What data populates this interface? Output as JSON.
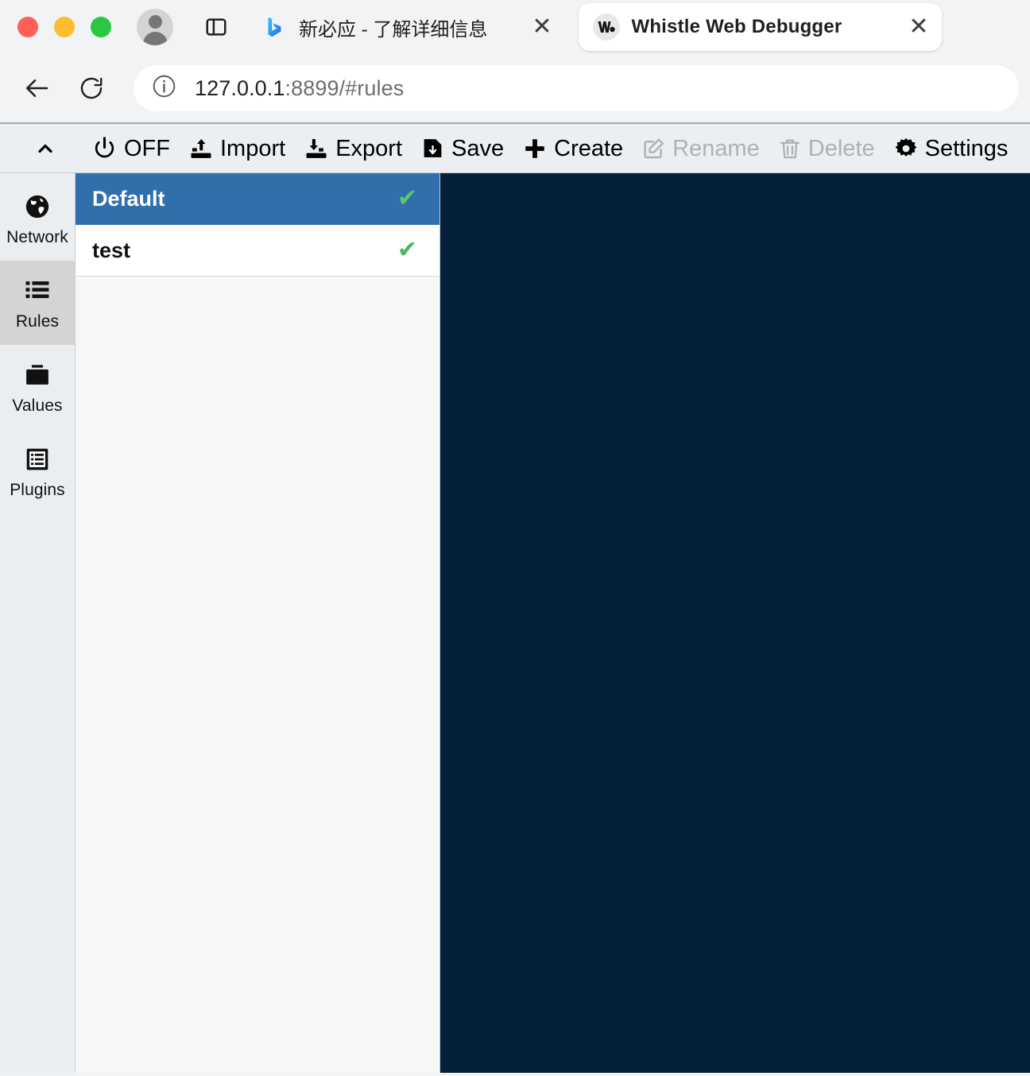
{
  "browser": {
    "window_controls": [
      "close",
      "minimize",
      "maximize"
    ],
    "profile_avatar": "account-avatar",
    "sidebar_toggle": "sidebar-toggle-icon",
    "tabs": [
      {
        "title": "新必应 - 了解详细信息",
        "favicon": "bing-icon",
        "close": "✕",
        "active": false
      },
      {
        "title": "Whistle Web Debugger",
        "favicon": "whistle-icon",
        "close": "✕",
        "active": true
      }
    ],
    "nav": {
      "back": "back-arrow-icon",
      "reload": "reload-icon",
      "info": "info-icon"
    },
    "omnibox": {
      "host": "127.0.0.1",
      "path": ":8899/#rules"
    }
  },
  "whistle": {
    "toolbar": {
      "collapse": "chevron-up-icon",
      "items": [
        {
          "label": "OFF",
          "icon": "power-icon",
          "disabled": false
        },
        {
          "label": "Import",
          "icon": "import-icon",
          "disabled": false
        },
        {
          "label": "Export",
          "icon": "export-icon",
          "disabled": false
        },
        {
          "label": "Save",
          "icon": "save-icon",
          "disabled": false
        },
        {
          "label": "Create",
          "icon": "plus-icon",
          "disabled": false
        },
        {
          "label": "Rename",
          "icon": "rename-icon",
          "disabled": true
        },
        {
          "label": "Delete",
          "icon": "trash-icon",
          "disabled": true
        },
        {
          "label": "Settings",
          "icon": "gear-icon",
          "disabled": false
        }
      ],
      "console": "terminal-prompt-icon"
    },
    "sidebar": {
      "items": [
        {
          "label": "Network",
          "icon": "globe-icon",
          "active": false
        },
        {
          "label": "Rules",
          "icon": "list-icon",
          "active": true
        },
        {
          "label": "Values",
          "icon": "folder-icon",
          "active": false
        },
        {
          "label": "Plugins",
          "icon": "plugins-icon",
          "active": false
        }
      ]
    },
    "rules_list": [
      {
        "name": "Default",
        "enabled_mark": "✔",
        "selected": true
      },
      {
        "name": "test",
        "enabled_mark": "✔",
        "selected": false
      }
    ],
    "editor": {
      "content": "",
      "background": "#04203b"
    }
  },
  "colors": {
    "accent_selected": "#306fab",
    "check_green": "#4cb45f",
    "editor_bg": "#04203b",
    "sidebar_bg": "#ebeef0",
    "toolbar_bg": "#eceff1"
  }
}
